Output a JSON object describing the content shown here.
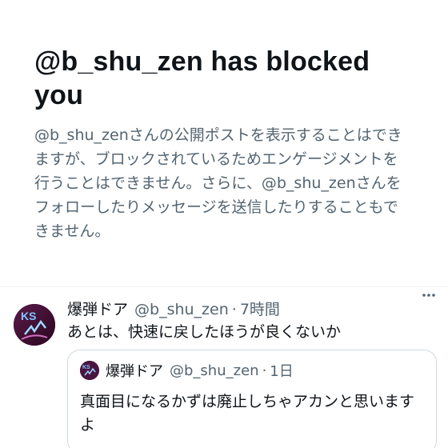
{
  "blocked": {
    "title": "@b_shu_zen has blocked you",
    "description": "@b_shu_zenさんの公開ポストを表示することはできますが、ブロックされているためエンゲージメントを行うことはできません。さらに、@b_shu_zenさんをフォローしたりメッセージを送信したりすることもできません。"
  },
  "tweet": {
    "display_name": "爆弾ドア",
    "handle": "@b_shu_zen",
    "separator": "·",
    "time": "7時間",
    "more_icon": "more-horizontal-icon",
    "text": "あとは、快速に戻したほうが良くないか"
  },
  "quote": {
    "display_name": "爆弾ドア",
    "handle": "@b_shu_zen",
    "separator": "·",
    "time": "1日",
    "text": "真面目になるかずは廃止しちゃアカンと思いますよ"
  },
  "colors": {
    "text_primary": "#0f1419",
    "text_secondary": "#536471",
    "border": "#cfd9de",
    "divider": "#eff3f4"
  }
}
